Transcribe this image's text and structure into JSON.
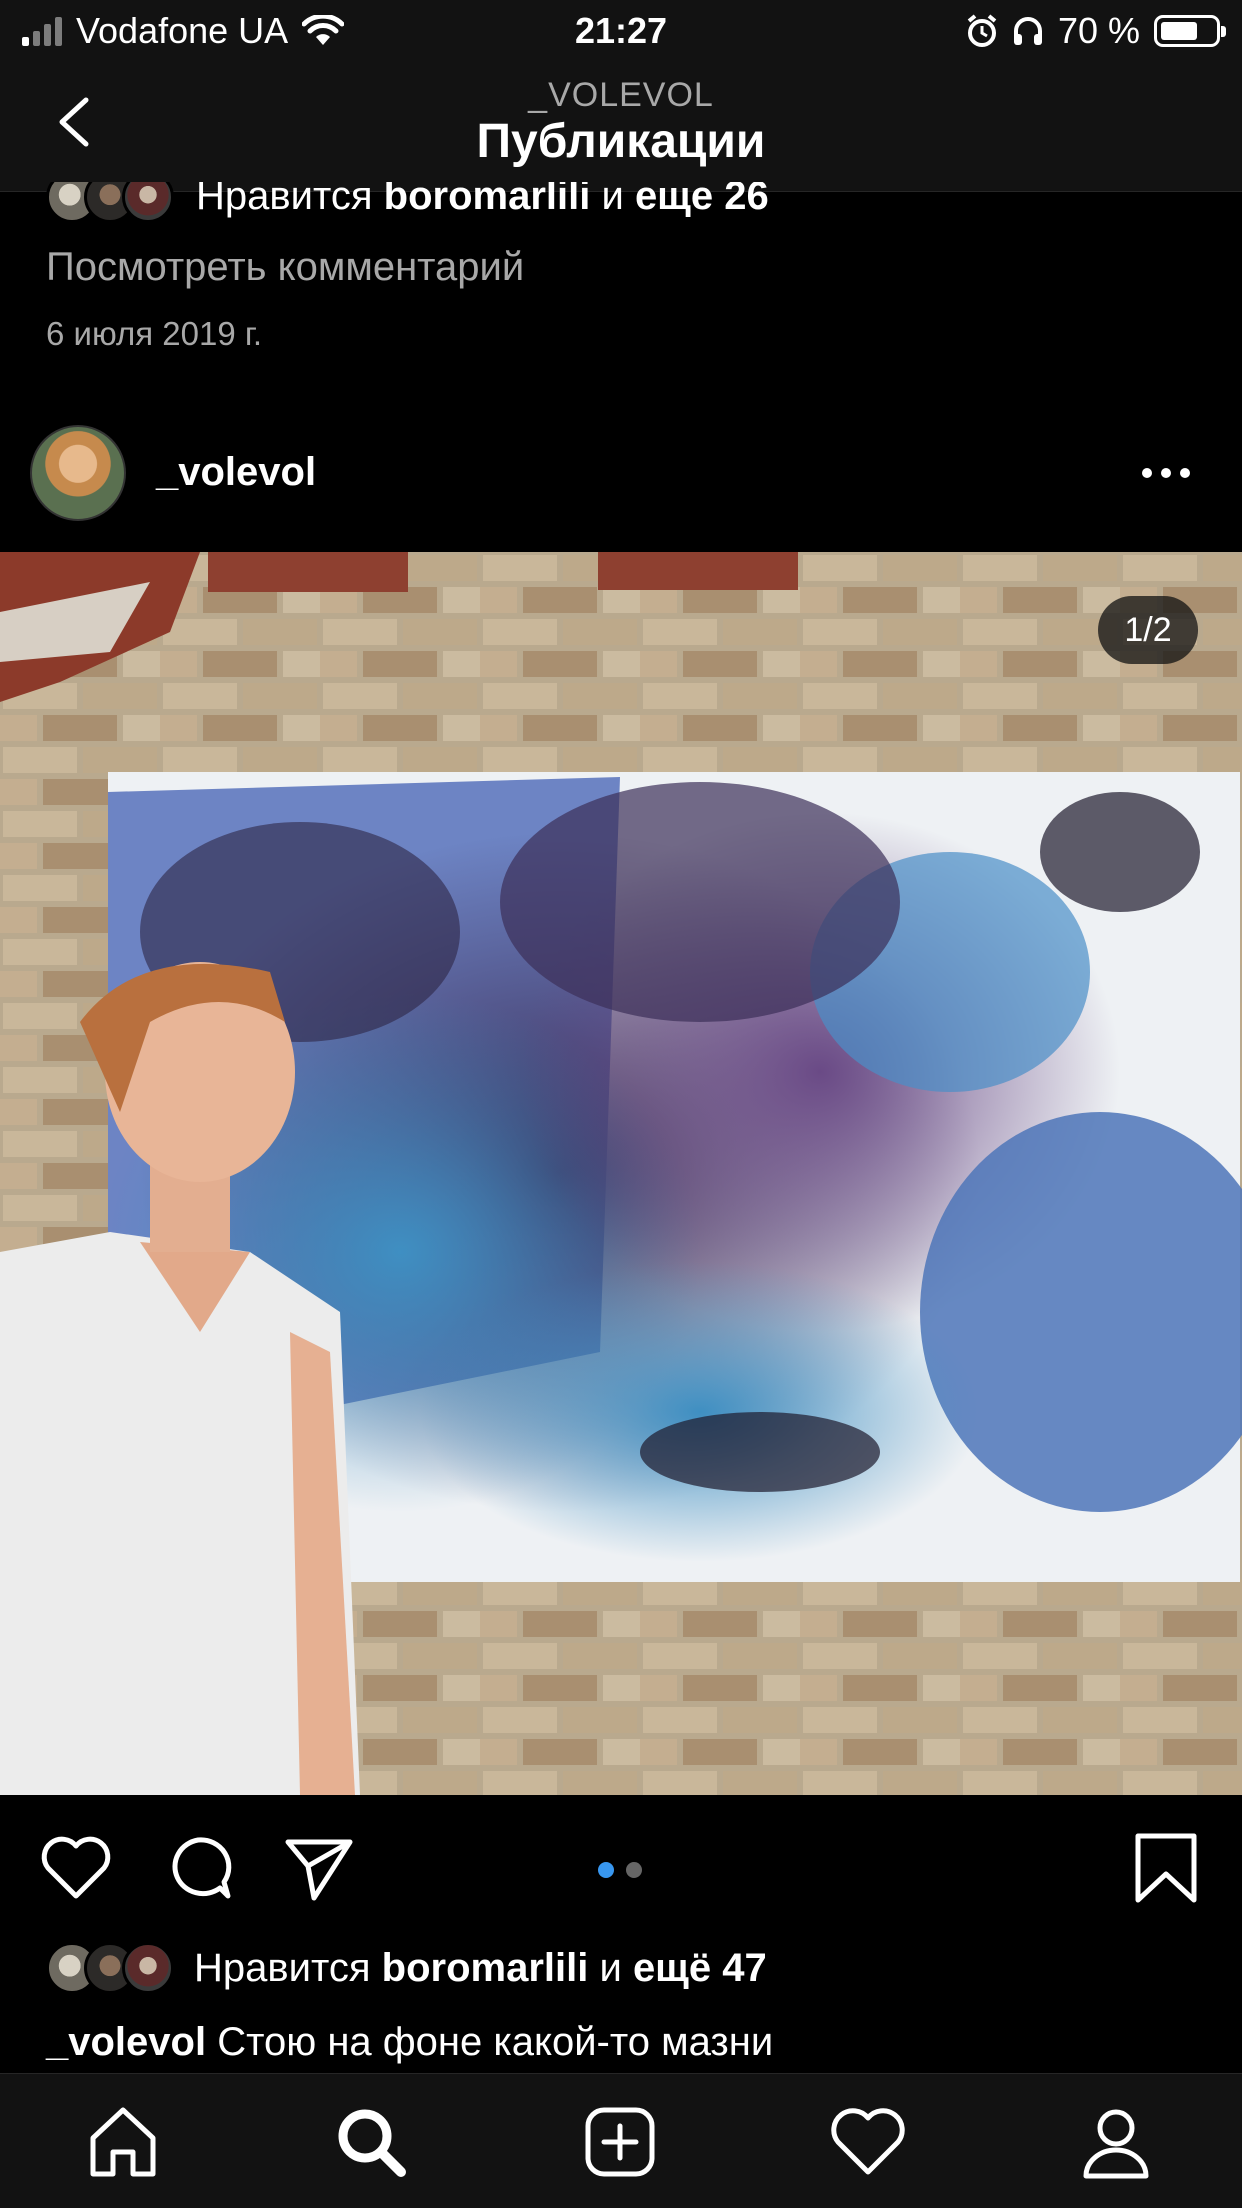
{
  "status_bar": {
    "carrier": "Vodafone UA",
    "time": "21:27",
    "battery": "70 %"
  },
  "navbar": {
    "account": "_VOLEVOL",
    "title": "Публикации"
  },
  "previous_post": {
    "likes_prefix": "Нравится",
    "liked_by": "boromarlili",
    "and_more": "и",
    "more_count": "еще 26",
    "view_comments": "Посмотреть комментарий",
    "date": "6 июля 2019 г."
  },
  "post": {
    "username": "_volevol",
    "image_counter": "1/2",
    "likes_prefix": "Нравится",
    "liked_by": "boromarlili",
    "and_more": "и",
    "more_count": "ещё 47",
    "caption_user": "_volevol",
    "caption_text": "Стою на фоне какой-то мазни",
    "carousel_total": 2,
    "carousel_active": 1
  },
  "icons": {
    "back": "chevron-left-icon",
    "more": "more-dots-icon",
    "like": "heart-icon",
    "comment": "comment-icon",
    "share": "paper-plane-icon",
    "save": "bookmark-icon",
    "tabs": [
      "home-icon",
      "search-icon",
      "add-post-icon",
      "activity-heart-icon",
      "profile-icon"
    ]
  },
  "colors": {
    "background": "#000000",
    "bar": "#121212",
    "accent": "#3897f0",
    "muted": "#a8a8a8"
  }
}
